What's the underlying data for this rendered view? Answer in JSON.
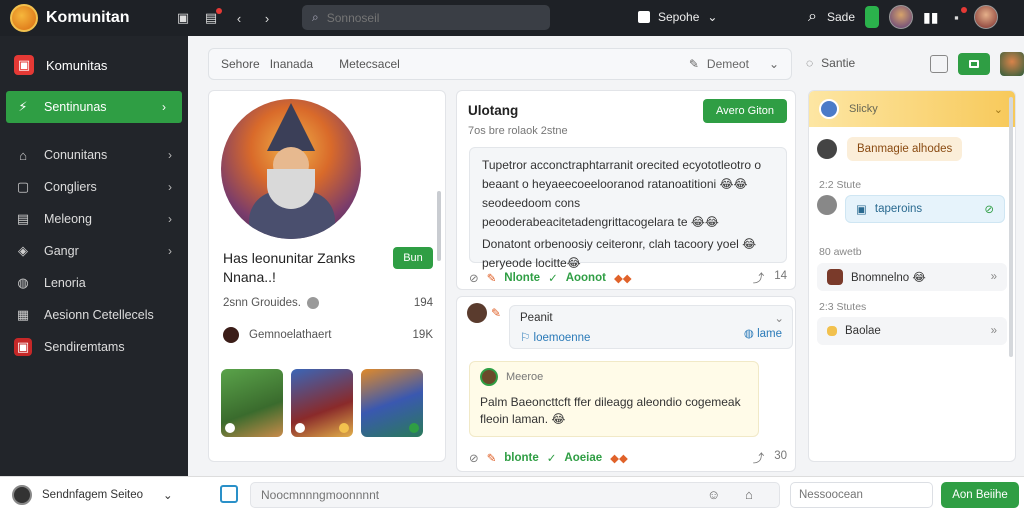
{
  "app": {
    "brand": "Komunitan"
  },
  "search": {
    "placeholder": "Sonnoseil"
  },
  "topbar": {
    "support": "Sepohe",
    "user_label": "Sade"
  },
  "sidebar": {
    "header": "Komunitas",
    "active": "Sentinunas",
    "items": [
      {
        "label": "Conunitans",
        "icon": "home-icon"
      },
      {
        "label": "Congliers",
        "icon": "chat-icon"
      },
      {
        "label": "Meleong",
        "icon": "calendar-icon"
      },
      {
        "label": "Gangr",
        "icon": "tag-icon"
      },
      {
        "label": "Lenoria",
        "icon": "user-icon"
      },
      {
        "label": "Aesionn Cetellecels",
        "icon": "cart-icon"
      },
      {
        "label": "Sendiremtams",
        "icon": "settings-icon"
      }
    ]
  },
  "filterbar": {
    "left_a": "Sehore",
    "left_b": "Inanada",
    "left_c": "Metecsacel",
    "right": "Demeot"
  },
  "share": {
    "label": "Santie"
  },
  "profile": {
    "name": "Has leonunitar Zanks Nnana..!",
    "follow": "Bun",
    "stat1_label": "2snn Grouides.",
    "stat1_value": "194",
    "stat2_label": "Gemnoelathaert",
    "stat2_value": "19K"
  },
  "post": {
    "title": "Ulotang",
    "meta": "7os bre rolaok  2stne",
    "cta": "Avero Giton",
    "body_p1": "Tupetror acconctraphtarranit orecited ecyototleotro o beaant o heyaeecoeelooranod ratanoatitioni 😂😂 seodeedoom cons peooderabeacitetadengrittacogelara te 😂😂",
    "body_p2": "Donatont orbenoosiy ceiteronr, clah tacoory yoel 😂 peryeode locitte😂",
    "react_a": "Nlonte",
    "react_b": "Aoonot",
    "react_count": "14"
  },
  "thread": {
    "reply_name": "Peanit",
    "reply_tag": "loemoenne",
    "reply_tag_right": "lame",
    "quote_author": "Meeroe",
    "quote_text": "Palm Baeoncttcft ffer dileagg aleondio cogemeak fleoin laman. 😂",
    "react_a": "blonte",
    "react_b": "Aoeiae",
    "react_count": "30"
  },
  "rpanel": {
    "head": "Slicky",
    "pill": "Banmagie alhodes",
    "time1": "2:2  Stute",
    "card1": "taperoins",
    "time2": "80  awetb",
    "card2": "Bnomnelno 😂",
    "time3": "2:3  Stutes",
    "card3": "Baolae"
  },
  "bottombar": {
    "user": "Sendnfagem Seiteo",
    "composer_placeholder": "Noocmnnngmoonnnnt",
    "name_placeholder": "Nessoocean",
    "send": "Aon Beiihe"
  }
}
